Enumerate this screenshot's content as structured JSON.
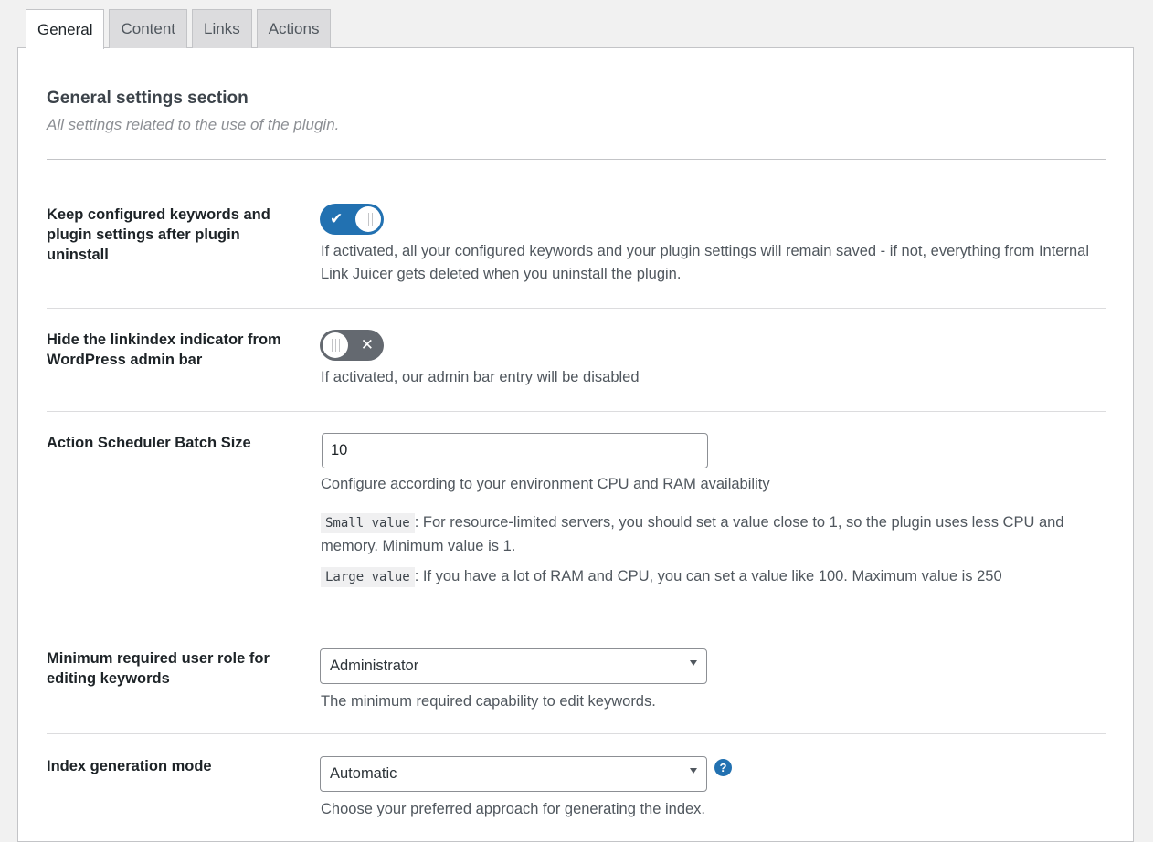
{
  "tabs": [
    {
      "label": "General",
      "active": true
    },
    {
      "label": "Content",
      "active": false
    },
    {
      "label": "Links",
      "active": false
    },
    {
      "label": "Actions",
      "active": false
    }
  ],
  "section": {
    "title": "General settings section",
    "description": "All settings related to the use of the plugin."
  },
  "settings": {
    "keep_settings": {
      "label": "Keep configured keywords and plugin settings after plugin uninstall",
      "enabled": true,
      "on_glyph": "✔",
      "description": "If activated, all your configured keywords and your plugin settings will remain saved - if not, everything from Internal Link Juicer gets deleted when you uninstall the plugin."
    },
    "hide_indicator": {
      "label": "Hide the linkindex indicator from WordPress admin bar",
      "enabled": false,
      "off_glyph": "✕",
      "description": "If activated, our admin bar entry will be disabled"
    },
    "batch_size": {
      "label": "Action Scheduler Batch Size",
      "value": "10",
      "description": "Configure according to your environment CPU and RAM availability",
      "small_code": "Small value",
      "small_text": ": For resource-limited servers, you should set a value close to 1, so the plugin uses less CPU and memory. Minimum value is 1.",
      "large_code": "Large value",
      "large_text": ": If you have a lot of RAM and CPU, you can set a value like 100. Maximum value is 250"
    },
    "user_role": {
      "label": "Minimum required user role for editing keywords",
      "selected": "Administrator",
      "description": "The minimum required capability to edit keywords."
    },
    "index_mode": {
      "label": "Index generation mode",
      "selected": "Automatic",
      "help_glyph": "?",
      "description": "Choose your preferred approach for generating the index."
    }
  },
  "colors": {
    "accent": "#2271b1",
    "toggle_off": "#646970"
  }
}
